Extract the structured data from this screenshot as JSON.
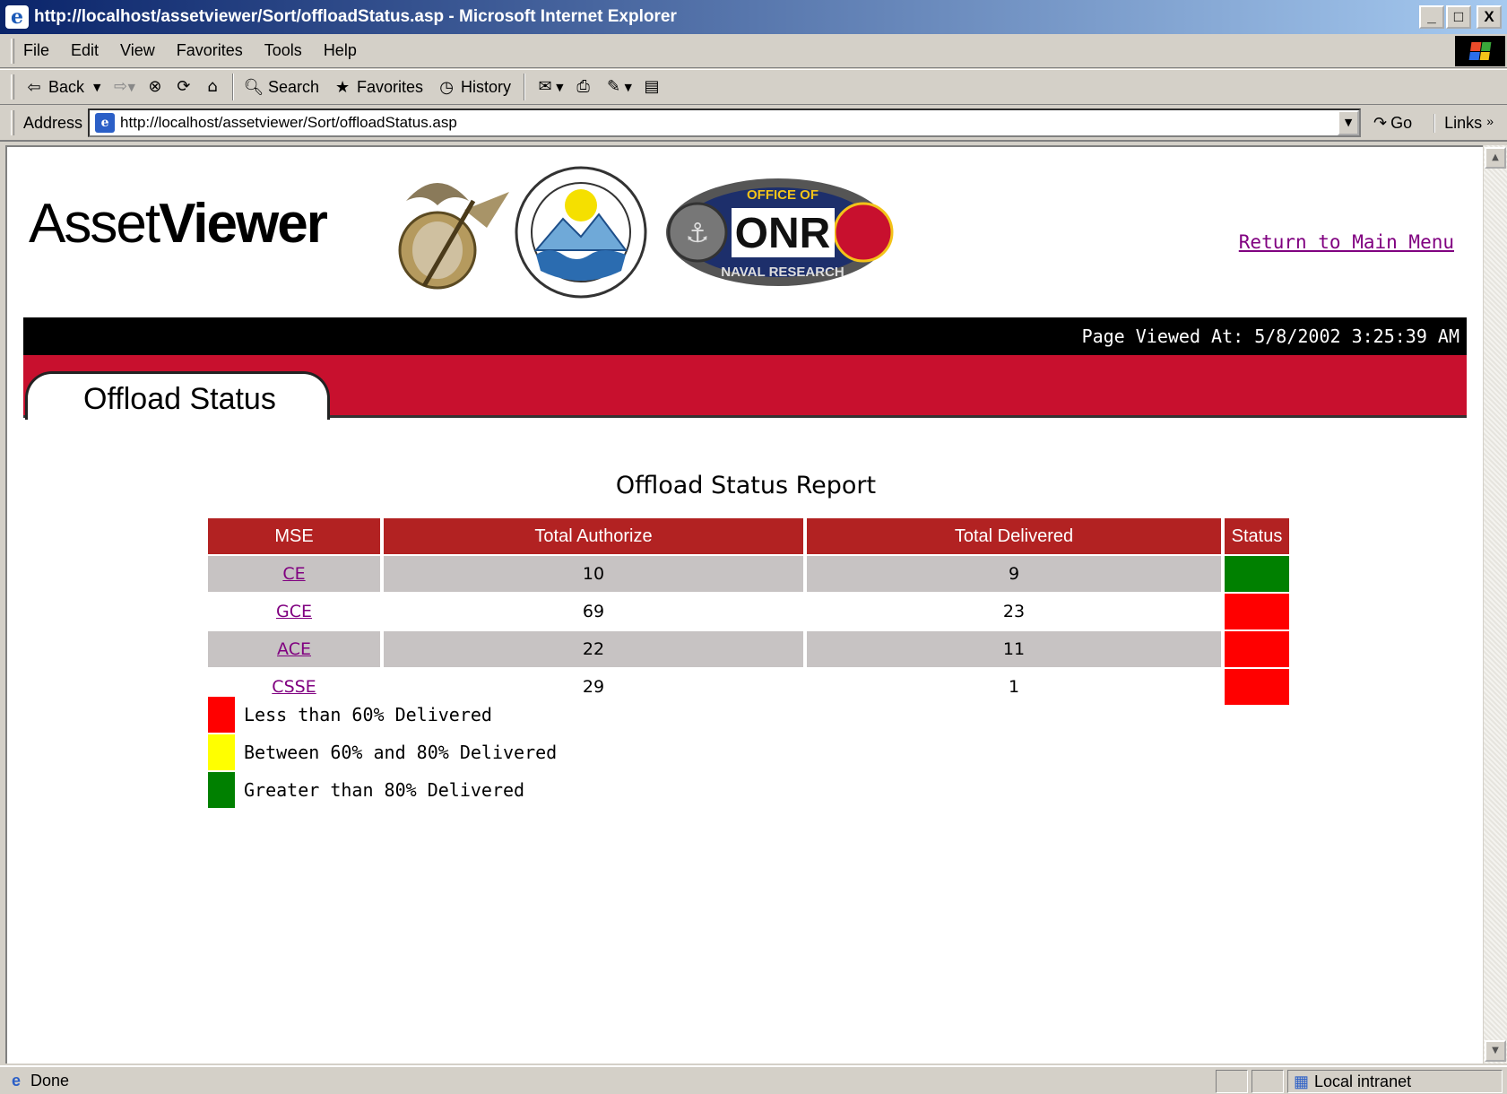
{
  "window": {
    "title": "http://localhost/assetviewer/Sort/offloadStatus.asp - Microsoft Internet Explorer",
    "buttons": [
      "_",
      "□",
      "X"
    ]
  },
  "menu": [
    "File",
    "Edit",
    "View",
    "Favorites",
    "Tools",
    "Help"
  ],
  "toolbar": {
    "back": "Back",
    "search": "Search",
    "favorites": "Favorites",
    "history": "History"
  },
  "address": {
    "label": "Address",
    "url": "http://localhost/assetviewer/Sort/offloadStatus.asp",
    "go": "Go",
    "links": "Links"
  },
  "page": {
    "logo_light": "Asset",
    "logo_bold": "Viewer",
    "return_link": "Return to Main Menu",
    "viewed_at": "Page Viewed At: 5/8/2002 3:25:39 AM",
    "tab_label": "Offload Status",
    "report_title": "Offload Status Report",
    "emblem_onr_text": "OFFICE OF",
    "emblem_onr_big": "ONR",
    "emblem_onr_bottom": "NAVAL RESEARCH"
  },
  "table": {
    "headers": [
      "MSE",
      "Total Authorize",
      "Total Delivered",
      "Status"
    ],
    "rows": [
      {
        "mse": "CE",
        "authorized": "10",
        "delivered": "9",
        "status_color": "#008000"
      },
      {
        "mse": "GCE",
        "authorized": "69",
        "delivered": "23",
        "status_color": "#ff0000"
      },
      {
        "mse": "ACE",
        "authorized": "22",
        "delivered": "11",
        "status_color": "#ff0000"
      },
      {
        "mse": "CSSE",
        "authorized": "29",
        "delivered": "1",
        "status_color": "#ff0000"
      }
    ]
  },
  "legend": [
    {
      "color": "#ff0000",
      "label": "Less than 60% Delivered"
    },
    {
      "color": "#ffff00",
      "label": "Between 60% and 80% Delivered"
    },
    {
      "color": "#008000",
      "label": "Greater than 80% Delivered"
    }
  ],
  "status_bar": {
    "text": "Done",
    "zone": "Local intranet"
  }
}
